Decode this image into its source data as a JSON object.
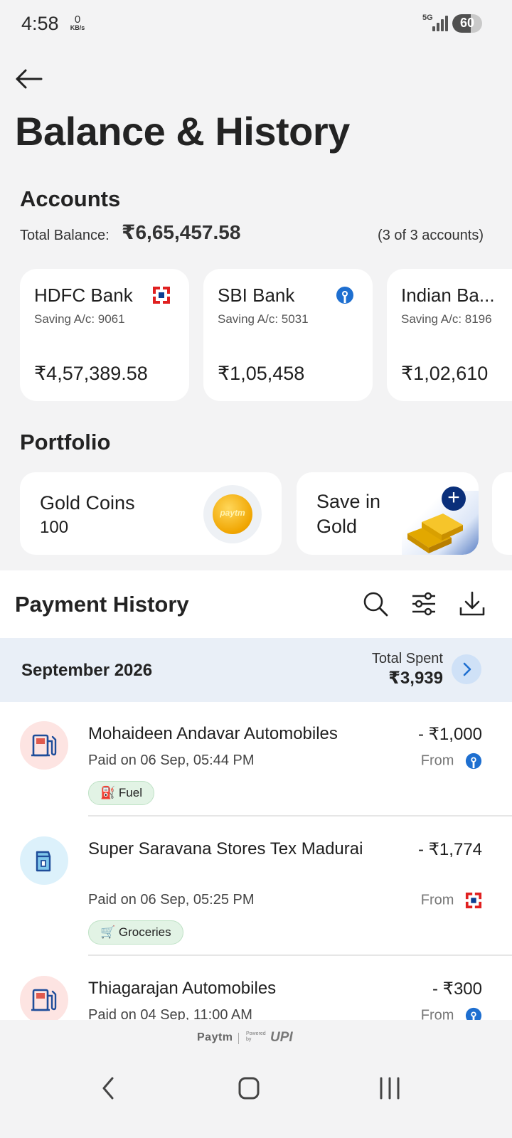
{
  "status_bar": {
    "time": "4:58",
    "net_speed": "0",
    "net_unit": "KB/s",
    "network": "5G",
    "battery": "60"
  },
  "header": {
    "title": "Balance & History"
  },
  "accounts": {
    "title": "Accounts",
    "total_label": "Total Balance:",
    "total_value": "₹6,65,457.58",
    "count": "(3 of 3 accounts)",
    "cards": [
      {
        "bank": "HDFC Bank",
        "account": "Saving A/c: 9061",
        "balance": "₹4,57,389.58",
        "logo": "hdfc-logo-icon"
      },
      {
        "bank": "SBI Bank",
        "account": "Saving A/c: 5031",
        "balance": "₹1,05,458",
        "logo": "sbi-logo-icon"
      },
      {
        "bank": "Indian Ba...",
        "account": "Saving A/c: 8196",
        "balance": "₹1,02,610",
        "logo": ""
      }
    ]
  },
  "portfolio": {
    "title": "Portfolio",
    "gold_coins": {
      "label": "Gold Coins",
      "value": "100",
      "coin_text": "paytm"
    },
    "save_gold": {
      "label": "Save in Gold",
      "action": "+"
    }
  },
  "payment_history": {
    "title": "Payment History",
    "month": "September 2026",
    "total_spent_label": "Total Spent",
    "total_spent_value": "₹3,939",
    "transactions": [
      {
        "name": "Mohaideen Andavar Automobiles",
        "date": "Paid on 06 Sep, 05:44 PM",
        "amount": "- ₹1,000",
        "from": "From",
        "tag": "Fuel",
        "tag_icon": "⛽",
        "icon": "fuel-pump-icon",
        "source_logo": "sbi-logo-icon"
      },
      {
        "name": "Super Saravana Stores Tex Madurai",
        "date": "Paid on 06 Sep, 05:25 PM",
        "amount": "- ₹1,774",
        "from": "From",
        "tag": "Groceries",
        "tag_icon": "🛒",
        "icon": "grocery-icon",
        "source_logo": "hdfc-logo-icon"
      },
      {
        "name": "Thiagarajan Automobiles",
        "date": "Paid on 04 Sep, 11:00 AM",
        "amount": "- ₹300",
        "from": "From",
        "tag": "",
        "tag_icon": "",
        "icon": "fuel-pump-icon",
        "source_logo": "sbi-logo-icon"
      }
    ]
  },
  "footer": {
    "brand": "Paytm",
    "powered_by": "Powered by",
    "upi": "UPI"
  },
  "colors": {
    "accent_blue": "#0a2f7a",
    "hdfc_red": "#e02020",
    "sbi_blue": "#1e6fd0",
    "month_bg": "#e9eff7"
  }
}
